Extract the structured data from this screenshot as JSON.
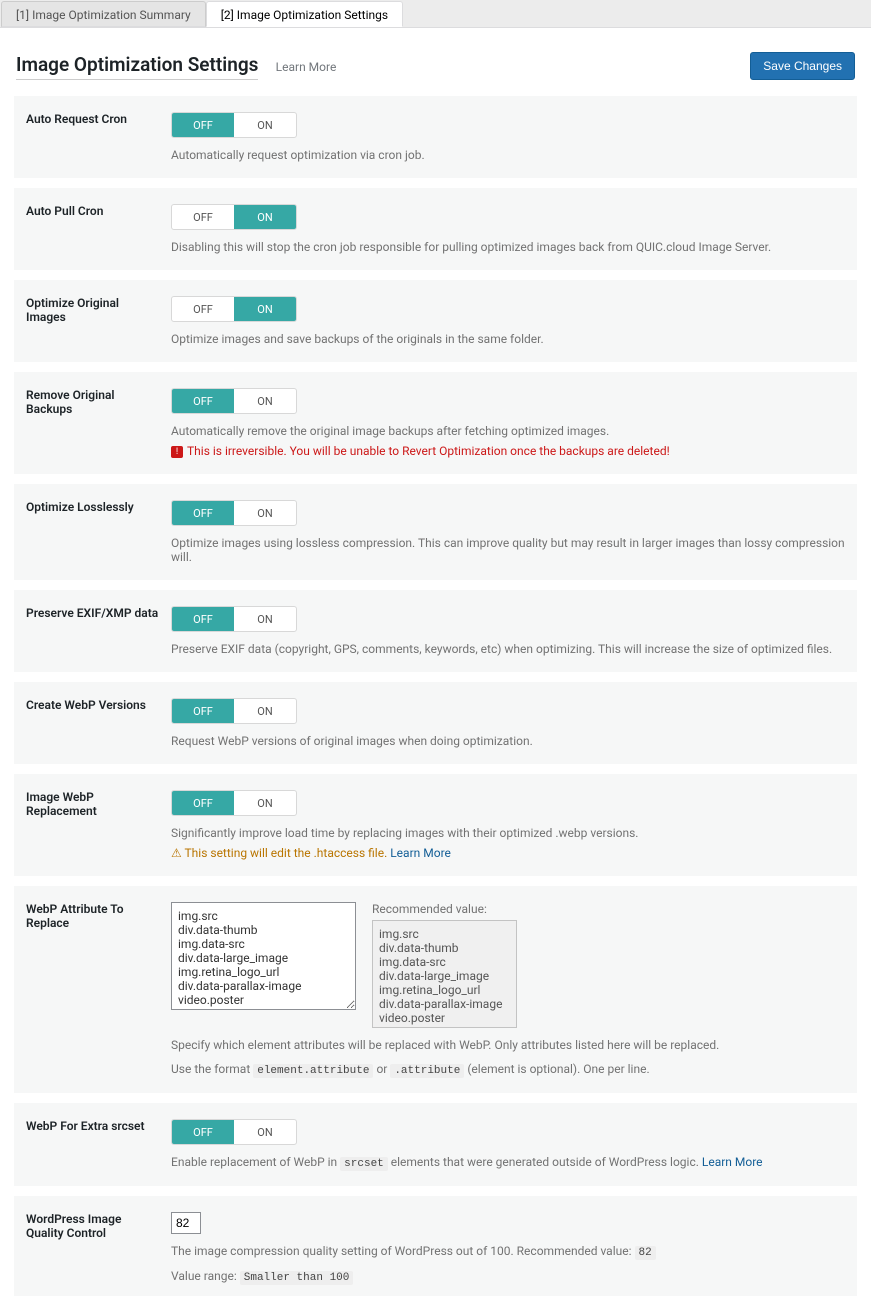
{
  "tabs": {
    "summary": "[1] Image Optimization Summary",
    "settings": "[2] Image Optimization Settings"
  },
  "header": {
    "title": "Image Optimization Settings",
    "learn_more": "Learn More",
    "save": "Save Changes"
  },
  "common": {
    "on": "ON",
    "off": "OFF"
  },
  "rows": {
    "auto_request": {
      "label": "Auto Request Cron",
      "desc": "Automatically request optimization via cron job."
    },
    "auto_pull": {
      "label": "Auto Pull Cron",
      "desc": "Disabling this will stop the cron job responsible for pulling optimized images back from QUIC.cloud Image Server."
    },
    "opt_orig": {
      "label": "Optimize Original Images",
      "desc": "Optimize images and save backups of the originals in the same folder."
    },
    "rm_backup": {
      "label": "Remove Original Backups",
      "desc": "Automatically remove the original image backups after fetching optimized images.",
      "warn": "This is irreversible. You will be unable to Revert Optimization once the backups are deleted!"
    },
    "lossless": {
      "label": "Optimize Losslessly",
      "desc": "Optimize images using lossless compression. This can improve quality but may result in larger images than lossy compression will."
    },
    "exif": {
      "label": "Preserve EXIF/XMP data",
      "desc": "Preserve EXIF data (copyright, GPS, comments, keywords, etc) when optimizing. This will increase the size of optimized files."
    },
    "create_webp": {
      "label": "Create WebP Versions",
      "desc": "Request WebP versions of original images when doing optimization."
    },
    "webp_replace": {
      "label": "Image WebP Replacement",
      "desc": "Significantly improve load time by replacing images with their optimized .webp versions.",
      "warn": "This setting will edit the .htaccess file.",
      "learn": "Learn More"
    },
    "attr": {
      "label": "WebP Attribute To Replace",
      "value": "img.src\ndiv.data-thumb\nimg.data-src\ndiv.data-large_image\nimg.retina_logo_url\ndiv.data-parallax-image\nvideo.poster",
      "rec_label": "Recommended value:",
      "rec_value": "img.src\ndiv.data-thumb\nimg.data-src\ndiv.data-large_image\nimg.retina_logo_url\ndiv.data-parallax-image\nvideo.poster",
      "desc1": "Specify which element attributes will be replaced with WebP. Only attributes listed here will be replaced.",
      "desc2a": "Use the format ",
      "code1": "element.attribute",
      "desc2b": " or ",
      "code2": ".attribute",
      "desc2c": " (element is optional). One per line."
    },
    "extra_srcset": {
      "label": "WebP For Extra srcset",
      "desc_a": "Enable replacement of WebP in ",
      "code": "srcset",
      "desc_b": " elements that were generated outside of WordPress logic. ",
      "learn": "Learn More"
    },
    "quality": {
      "label": "WordPress Image Quality Control",
      "value": "82",
      "desc_a": "The image compression quality setting of WordPress out of 100. Recommended value: ",
      "rec": "82",
      "range_a": "Value range: ",
      "range": "Smaller than 100"
    }
  }
}
